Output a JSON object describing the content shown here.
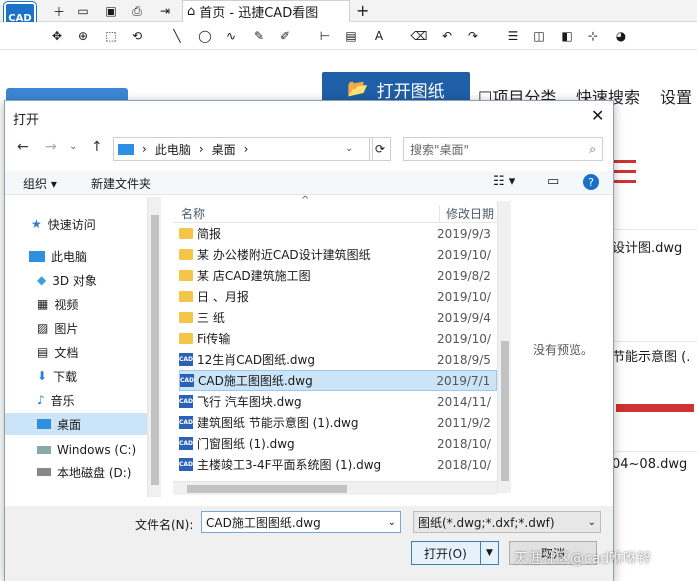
{
  "app": {
    "logo_text": "CAD",
    "tab_label": "首页 - 迅捷CAD看图",
    "new_tab": "+"
  },
  "header": {
    "open_button": "打开图纸",
    "project_category": "项目分类",
    "quick_search": "快速搜索",
    "settings": "设置"
  },
  "background": {
    "cards": [
      "设计图.dwg",
      "节能示意图 (.",
      "04~08.dwg"
    ]
  },
  "dialog": {
    "title": "打开",
    "address": {
      "segments": [
        "此电脑",
        "桌面"
      ]
    },
    "search_placeholder": "搜索\"桌面\"",
    "organize": "组织 ▾",
    "new_folder": "新建文件夹",
    "nav": [
      {
        "label": "快速访问",
        "icon": "star-icon"
      },
      {
        "label": "此电脑",
        "icon": "computer-icon"
      },
      {
        "label": "3D 对象",
        "icon": "cube-icon"
      },
      {
        "label": "视频",
        "icon": "video-icon"
      },
      {
        "label": "图片",
        "icon": "picture-icon"
      },
      {
        "label": "文档",
        "icon": "document-icon"
      },
      {
        "label": "下载",
        "icon": "download-icon"
      },
      {
        "label": "音乐",
        "icon": "music-icon"
      },
      {
        "label": "桌面",
        "icon": "desktop-icon"
      },
      {
        "label": "Windows (C:)",
        "icon": "drive-icon"
      },
      {
        "label": "本地磁盘 (D:)",
        "icon": "drive-icon"
      }
    ],
    "columns": {
      "name": "名称",
      "date": "修改日期"
    },
    "files": [
      {
        "name": "简报",
        "date": "2019/9/3",
        "type": "folder"
      },
      {
        "name": "某     办公楼附近CAD设计建筑图纸",
        "date": "2019/10/",
        "type": "folder"
      },
      {
        "name": "某     店CAD建筑施工图",
        "date": "2019/8/2",
        "type": "folder"
      },
      {
        "name": "日     、月报",
        "date": "2019/10/",
        "type": "folder"
      },
      {
        "name": "三     纸",
        "date": "2019/9/4",
        "type": "folder"
      },
      {
        "name": "             Fi传输",
        "date": "2019/10/",
        "type": "folder"
      },
      {
        "name": "12生肖CAD图纸.dwg",
        "date": "2018/9/5",
        "type": "cad"
      },
      {
        "name": "CAD施工图图纸.dwg",
        "date": "2019/7/1",
        "type": "cad",
        "selected": true
      },
      {
        "name": "飞行 汽车图块.dwg",
        "date": "2014/11/",
        "type": "cad"
      },
      {
        "name": "建筑图纸 节能示意图 (1).dwg",
        "date": "2011/9/2",
        "type": "cad"
      },
      {
        "name": "门窗图纸 (1).dwg",
        "date": "2018/10/",
        "type": "cad"
      },
      {
        "name": "主楼竣工3-4F平面系统图 (1).dwg",
        "date": "2018/10/",
        "type": "cad"
      }
    ],
    "preview_text": "没有预览。",
    "filename_label": "文件名(N):",
    "filename_value": "CAD施工图图纸.dwg",
    "filetype": "图纸(*.dwg;*.dxf;*.dwf)",
    "open_label": "打开(O)",
    "cancel_label": "取消"
  },
  "watermark": "天涯社区@cad咻咻锌",
  "colors": {
    "accent": "#1f5fa8",
    "selection": "#cce4f7",
    "folder": "#f5c54a",
    "cad_icon": "#2a62b8"
  }
}
